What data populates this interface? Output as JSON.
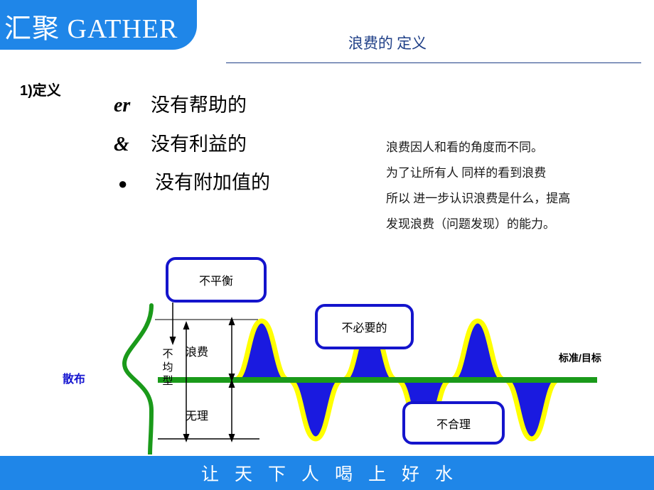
{
  "header": {
    "logo_text": "汇聚 GATHER",
    "logo_bg": "#1f86e8",
    "title": "浪费的 定义",
    "title_color": "#1f3f87"
  },
  "definition": {
    "section_label": "1)定义",
    "items": [
      {
        "mark": "er",
        "mark_icon": "script-er-bullet-icon",
        "text": "没有帮助的"
      },
      {
        "mark": "&",
        "mark_icon": "ampersand-bullet-icon",
        "text": "没有利益的"
      },
      {
        "mark": "●",
        "mark_icon": "filled-circle-bullet-icon",
        "text": "没有附加值的"
      }
    ]
  },
  "paragraph": {
    "lines": [
      "浪费因人和看的角度而不同。",
      "为了让所有人 同样的看到浪费",
      "所以 进一步认识浪费是什么，提高",
      "发现浪费（问题发现）的能力。"
    ]
  },
  "diagram": {
    "callouts": [
      {
        "label": "不平衡"
      },
      {
        "label": "不必要的"
      },
      {
        "label": "不合理"
      }
    ],
    "labels": {
      "scatter": "散布",
      "standard": "标准/目标",
      "waste": "浪费",
      "unreasonable": "无理",
      "uneven": "不均型"
    },
    "colors": {
      "wave_fill": "#1a1ae0",
      "wave_outline": "#ffff00",
      "baseline": "#1a9a1a",
      "distribution_curve": "#1a9a1a",
      "callout_border": "#1414cc",
      "arrow": "#000000"
    }
  },
  "footer": {
    "slogan": "让天下人喝上好水",
    "bg": "#1f86e8"
  }
}
